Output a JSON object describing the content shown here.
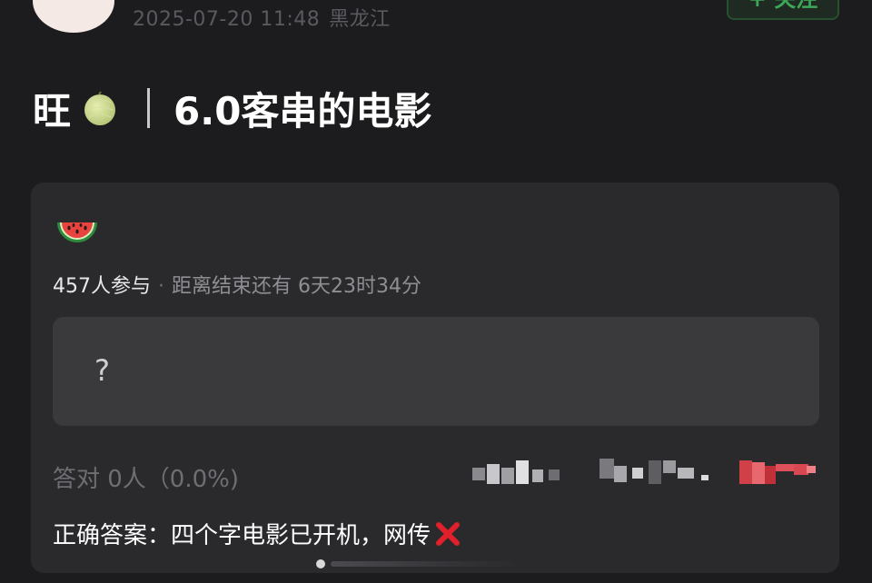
{
  "post": {
    "timestamp": "2025-07-20 11:48",
    "location": "黑龙江",
    "follow_label": "+ 关注",
    "title_prefix": "旺",
    "title_main": "6.0客串的电影"
  },
  "quiz": {
    "participants": "457人参与",
    "separator": "·",
    "countdown": "距离结束还有 6天23时34分",
    "option_text": "?",
    "correct_count": "答对  0人（0.0%)",
    "answer_text": "正确答案：四个字电影已开机，网传"
  },
  "icons": {
    "title_icon": "melon-icon",
    "card_icon": "watermelon-icon",
    "answer_icon": "cross-mark-icon"
  },
  "colors": {
    "background": "#1c1c1e",
    "card": "#2a2a2d",
    "option": "#3a3a3d",
    "follow_accent": "#3da659",
    "cross": "#e0202a"
  }
}
